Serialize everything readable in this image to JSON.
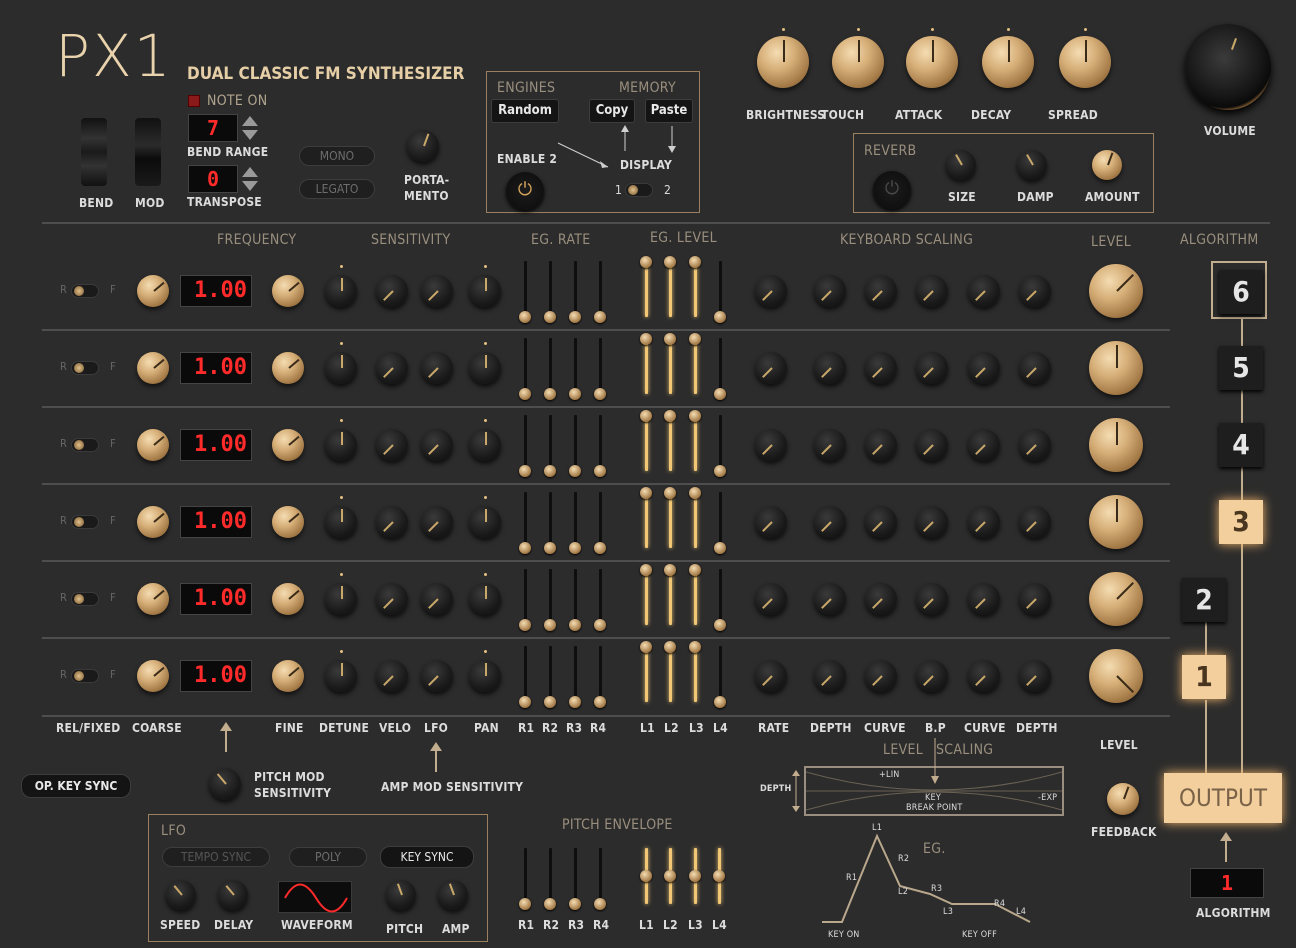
{
  "brand": {
    "logo": "PX1",
    "subtitle": "DUAL CLASSIC FM SYNTHESIZER"
  },
  "header": {
    "note_on": "NOTE ON",
    "bend": "BEND",
    "mod": "MOD",
    "bend_range_label": "BEND RANGE",
    "bend_range_value": "7",
    "transpose_label": "TRANSPOSE",
    "transpose_value": "0",
    "mono": "MONO",
    "legato": "LEGATO",
    "portamento": "PORTA-\nMENTO"
  },
  "engines": {
    "label": "ENGINES",
    "random": "Random",
    "memory": "MEMORY",
    "copy": "Copy",
    "paste": "Paste",
    "enable2": "ENABLE 2",
    "display": "DISPLAY",
    "d1": "1",
    "d2": "2"
  },
  "macros": [
    "BRIGHTNESS",
    "TOUCH",
    "ATTACK",
    "DECAY",
    "SPREAD"
  ],
  "volume": "VOLUME",
  "reverb": {
    "label": "REVERB",
    "size": "SIZE",
    "damp": "DAMP",
    "amount": "AMOUNT"
  },
  "section_headers": {
    "frequency": "FREQUENCY",
    "sensitivity": "SENSITIVITY",
    "eg_rate": "EG. RATE",
    "eg_level": "EG. LEVEL",
    "kbd_scaling": "KEYBOARD SCALING",
    "level": "LEVEL",
    "algorithm": "ALGORITHM"
  },
  "operators": [
    {
      "op": "6",
      "freq": "1.00"
    },
    {
      "op": "5",
      "freq": "1.00"
    },
    {
      "op": "4",
      "freq": "1.00"
    },
    {
      "op": "3",
      "freq": "1.00"
    },
    {
      "op": "2",
      "freq": "1.00"
    },
    {
      "op": "1",
      "freq": "1.00"
    }
  ],
  "rf": {
    "r": "R",
    "f": "F"
  },
  "column_labels": {
    "rel_fixed": "REL/FIXED",
    "coarse": "COARSE",
    "fine": "FINE",
    "detune": "DETUNE",
    "velo": "VELO",
    "lfo": "LFO",
    "pan": "PAN",
    "r1": "R1",
    "r2": "R2",
    "r3": "R3",
    "r4": "R4",
    "l1": "L1",
    "l2": "L2",
    "l3": "L3",
    "l4": "L4",
    "rate": "RATE",
    "depth": "DEPTH",
    "curve": "CURVE",
    "bp": "B.P",
    "curve2": "CURVE",
    "depth2": "DEPTH",
    "level": "LEVEL"
  },
  "bottom": {
    "op_key_sync": "OP. KEY SYNC",
    "pitch_mod_sens": "PITCH MOD\nSENSITIVITY",
    "amp_mod_sens": "AMP MOD SENSITIVITY",
    "level_scaling": "LEVEL   SCALING",
    "depth": "DEPTH",
    "plus_lin": "+LIN",
    "minus_exp": "-EXP",
    "key": "KEY",
    "break_point": "BREAK POINT",
    "feedback": "FEEDBACK",
    "output": "OUTPUT",
    "algorithm_label": "ALGORITHM",
    "algorithm_value": "1",
    "pitch_envelope": "PITCH ENVELOPE",
    "eg": "EG.",
    "eg_labels": {
      "l1": "L1",
      "r1": "R1",
      "r2": "R2",
      "l2": "L2",
      "r3": "R3",
      "l3": "L3",
      "r4": "R4",
      "l4": "L4",
      "key_on": "KEY ON",
      "key_off": "KEY OFF"
    }
  },
  "lfo": {
    "label": "LFO",
    "tempo_sync": "TEMPO SYNC",
    "poly": "POLY",
    "key_sync": "KEY SYNC",
    "speed": "SPEED",
    "delay": "DELAY",
    "waveform": "WAVEFORM",
    "pitch": "PITCH",
    "amp": "AMP"
  },
  "colors": {
    "background": "#2c2c2c",
    "accent": "#d7b07a",
    "led": "#ff2a2a",
    "lit": "#f1c776"
  }
}
